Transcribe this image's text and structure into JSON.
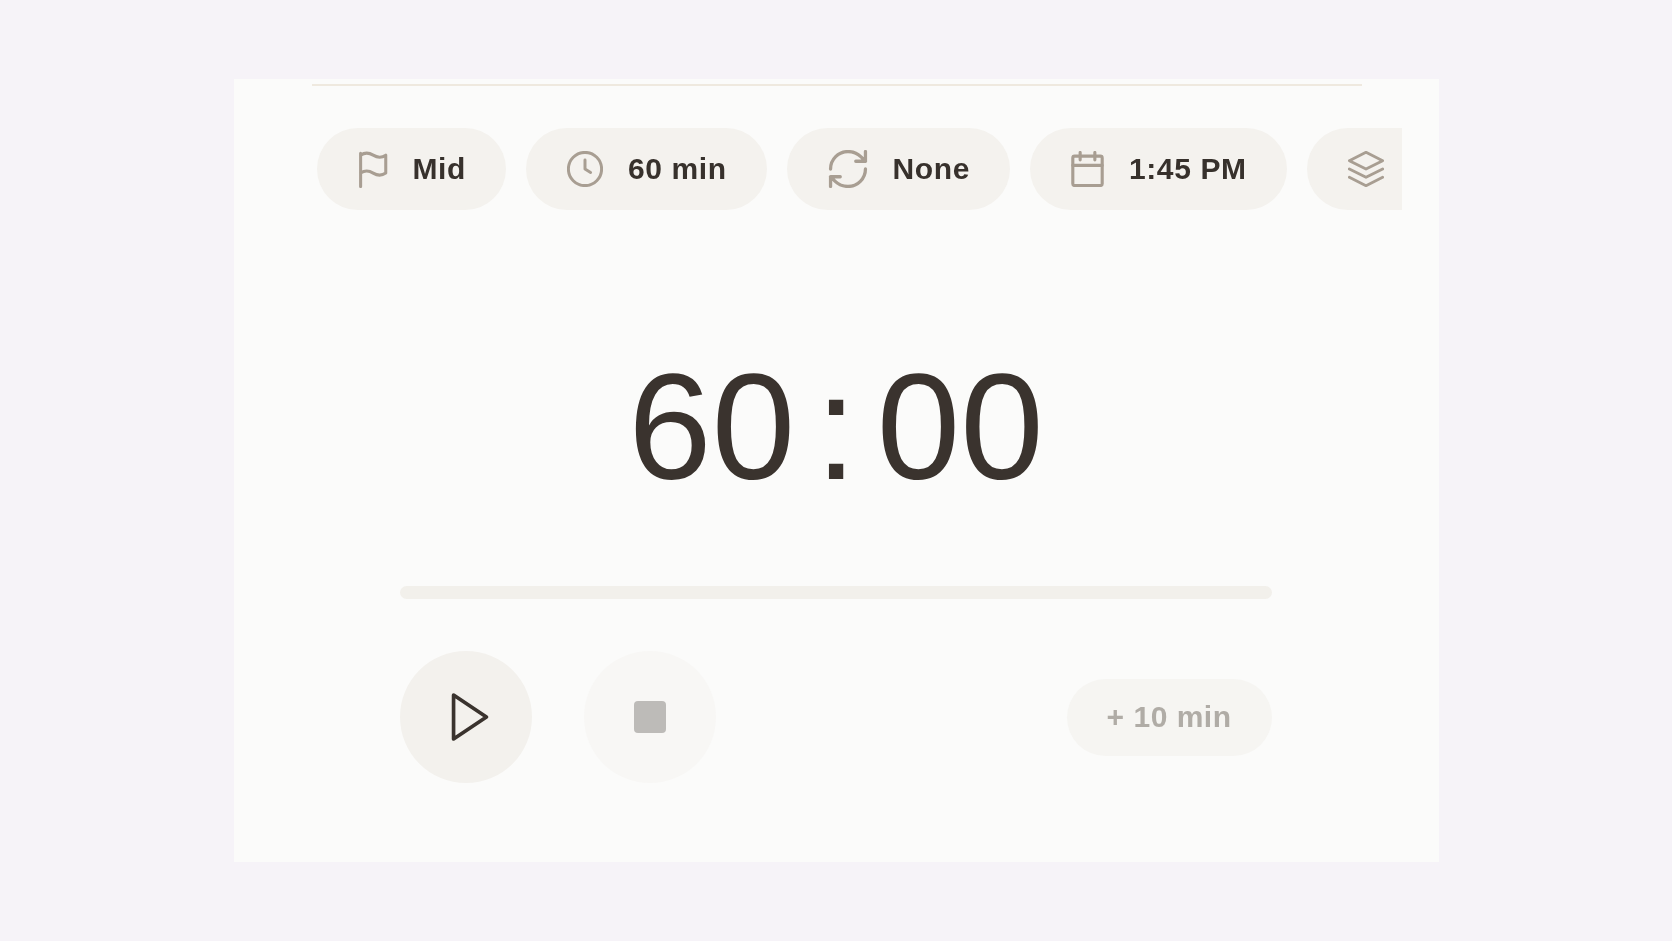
{
  "chips": [
    {
      "kind": "priority",
      "label": "Mid"
    },
    {
      "kind": "duration",
      "label": "60 min"
    },
    {
      "kind": "repeat",
      "label": "None"
    },
    {
      "kind": "schedule",
      "label": "1:45 PM"
    },
    {
      "kind": "stack"
    }
  ],
  "timer": {
    "minutes": "60",
    "separator": ":",
    "seconds": "00"
  },
  "controls": {
    "play": {
      "disabled": false
    },
    "stop": {
      "disabled": true
    },
    "extend": {
      "label": "+ 10 min",
      "disabled": true
    }
  }
}
